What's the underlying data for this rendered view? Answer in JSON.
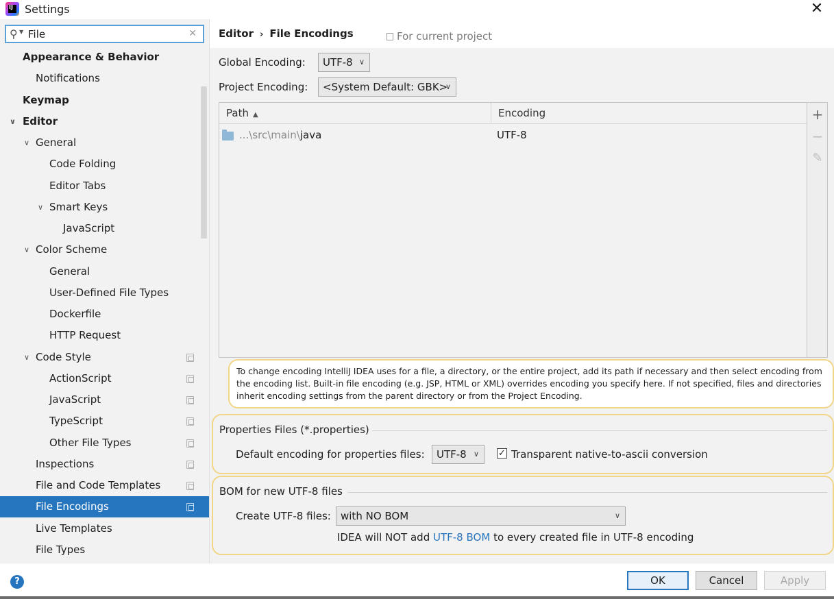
{
  "window": {
    "title": "Settings",
    "close_glyph": "✕"
  },
  "search": {
    "value": "File"
  },
  "sidebar": {
    "items": [
      {
        "label": "Appearance & Behavior",
        "level": 0,
        "bold": true
      },
      {
        "label": "Notifications",
        "level": 1
      },
      {
        "label": "Keymap",
        "level": 0,
        "bold": true
      },
      {
        "label": "Editor",
        "level": 0,
        "bold": true,
        "expanded": true
      },
      {
        "label": "General",
        "level": 1,
        "expanded": true
      },
      {
        "label": "Code Folding",
        "level": 2
      },
      {
        "label": "Editor Tabs",
        "level": 2
      },
      {
        "label": "Smart Keys",
        "level": 2,
        "expanded": true
      },
      {
        "label": "JavaScript",
        "level": 3
      },
      {
        "label": "Color Scheme",
        "level": 1,
        "expanded": true
      },
      {
        "label": "General",
        "level": 2
      },
      {
        "label": "User-Defined File Types",
        "level": 2
      },
      {
        "label": "Dockerfile",
        "level": 2
      },
      {
        "label": "HTTP Request",
        "level": 2
      },
      {
        "label": "Code Style",
        "level": 1,
        "expanded": true,
        "project": true
      },
      {
        "label": "ActionScript",
        "level": 2,
        "project": true
      },
      {
        "label": "JavaScript",
        "level": 2,
        "project": true
      },
      {
        "label": "TypeScript",
        "level": 2,
        "project": true
      },
      {
        "label": "Other File Types",
        "level": 2,
        "project": true
      },
      {
        "label": "Inspections",
        "level": 1,
        "project": true
      },
      {
        "label": "File and Code Templates",
        "level": 1,
        "project": true
      },
      {
        "label": "File Encodings",
        "level": 1,
        "project": true,
        "selected": true
      },
      {
        "label": "Live Templates",
        "level": 1
      },
      {
        "label": "File Types",
        "level": 1
      }
    ]
  },
  "header": {
    "crumb_parent": "Editor",
    "crumb_separator": "›",
    "crumb_current": "File Encodings",
    "scope_note": "For current project"
  },
  "encoding": {
    "global_label": "Global Encoding:",
    "global_value": "UTF-8",
    "project_label": "Project Encoding:",
    "project_value": "<System Default: GBK>"
  },
  "table": {
    "col_path": "Path",
    "col_encoding": "Encoding",
    "rows": [
      {
        "path_prefix": "...\\src\\main\\",
        "path_name": "java",
        "encoding": "UTF-8"
      }
    ],
    "tools": {
      "add": "+",
      "remove": "−",
      "edit": "✎"
    }
  },
  "hint_text": "To change encoding IntelliJ IDEA uses for a file, a directory, or the entire project, add its path if necessary and then select encoding from the encoding list. Built-in file encoding (e.g. JSP, HTML or XML) overrides encoding you specify here. If not specified, files and directories inherit encoding settings from the parent directory or from the Project Encoding.",
  "properties": {
    "title": "Properties Files (*.properties)",
    "default_label": "Default encoding for properties files:",
    "default_value": "UTF-8",
    "transparent_label": "Transparent native-to-ascii conversion",
    "transparent_checked": true,
    "check_glyph": "✓"
  },
  "bom": {
    "title": "BOM for new UTF-8 files",
    "create_label": "Create UTF-8 files:",
    "create_value": "with NO BOM",
    "note_prefix": "IDEA will NOT add",
    "note_link": "UTF-8 BOM",
    "note_suffix": "to every created file in UTF-8 encoding"
  },
  "footer": {
    "help": "?",
    "ok": "OK",
    "cancel": "Cancel",
    "apply": "Apply"
  },
  "colors": {
    "selection": "#2675bf",
    "highlight_border": "#f1d688",
    "panel_bg": "#f2f2f2"
  }
}
